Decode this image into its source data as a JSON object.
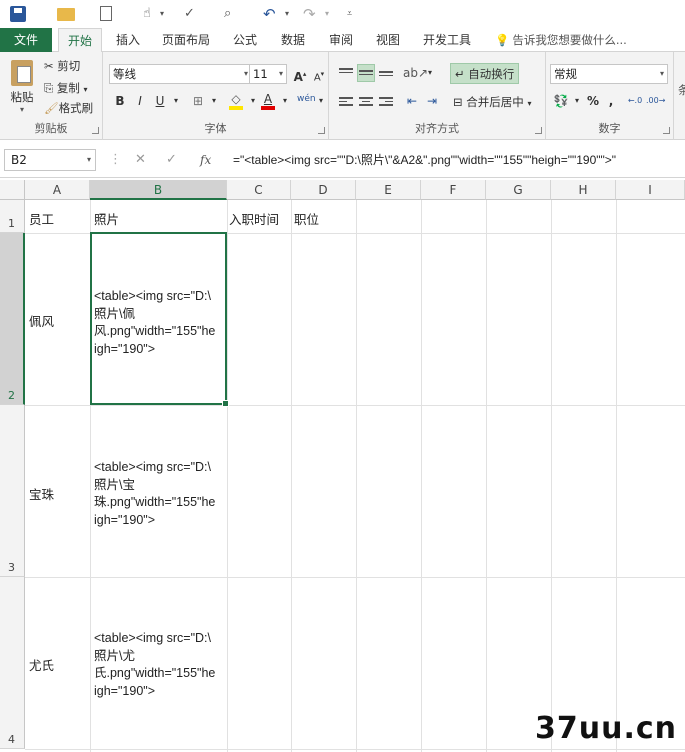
{
  "quick_access": {
    "icons": [
      "save-icon",
      "open-folder-icon",
      "new-document-icon",
      "touch-mode-icon",
      "spelling-icon",
      "print-preview-icon",
      "undo-icon",
      "redo-icon",
      "customize-qat-icon"
    ]
  },
  "tabs": [
    {
      "label": "文件"
    },
    {
      "label": "开始"
    },
    {
      "label": "插入"
    },
    {
      "label": "页面布局"
    },
    {
      "label": "公式"
    },
    {
      "label": "数据"
    },
    {
      "label": "审阅"
    },
    {
      "label": "视图"
    },
    {
      "label": "开发工具"
    }
  ],
  "tellme": "告诉我您想要做什么...",
  "ribbon": {
    "clipboard": {
      "paste": "粘贴",
      "cut": "剪切",
      "copy": "复制",
      "format_painter": "格式刷",
      "label": "剪贴板"
    },
    "font": {
      "name": "等线",
      "size": "11",
      "label": "字体",
      "bold": "B",
      "italic": "I",
      "underline": "U",
      "grow": "A",
      "shrink": "A",
      "phonetic": "wén"
    },
    "alignment": {
      "wrap": "自动换行",
      "merge": "合并后居中",
      "label": "对齐方式"
    },
    "number": {
      "format": "常规",
      "percent": "%",
      "comma": ",",
      "label": "数字"
    }
  },
  "formula_bar": {
    "name_box": "B2",
    "fx": "fx",
    "formula": "=\"<table><img src=\"\"D:\\照片\\\"&A2&\".png\"\"width=\"\"155\"\"heigh=\"\"190\"\">\""
  },
  "columns": [
    "A",
    "B",
    "C",
    "D",
    "E",
    "F",
    "G",
    "H",
    "I"
  ],
  "rows": [
    "1",
    "2",
    "3",
    "4"
  ],
  "cells": {
    "A1": "员工",
    "B1": "照片",
    "C1": "入职时间",
    "D1": "职位",
    "A2": "佩风",
    "B2": "<table><img src=\"D:\\\n照片\\佩\n风.png\"width=\"155\"he\nigh=\"190\">",
    "A3": "宝珠",
    "B3": "<table><img src=\"D:\\\n照片\\宝\n珠.png\"width=\"155\"he\nigh=\"190\">",
    "A4": "尤氏",
    "B4": "<table><img src=\"D:\\\n照片\\尤\n氏.png\"width=\"155\"he\nigh=\"190\">"
  },
  "watermark": "37uu.cn",
  "colors": {
    "accent": "#217346",
    "header_bg": "#f3f3f3"
  }
}
